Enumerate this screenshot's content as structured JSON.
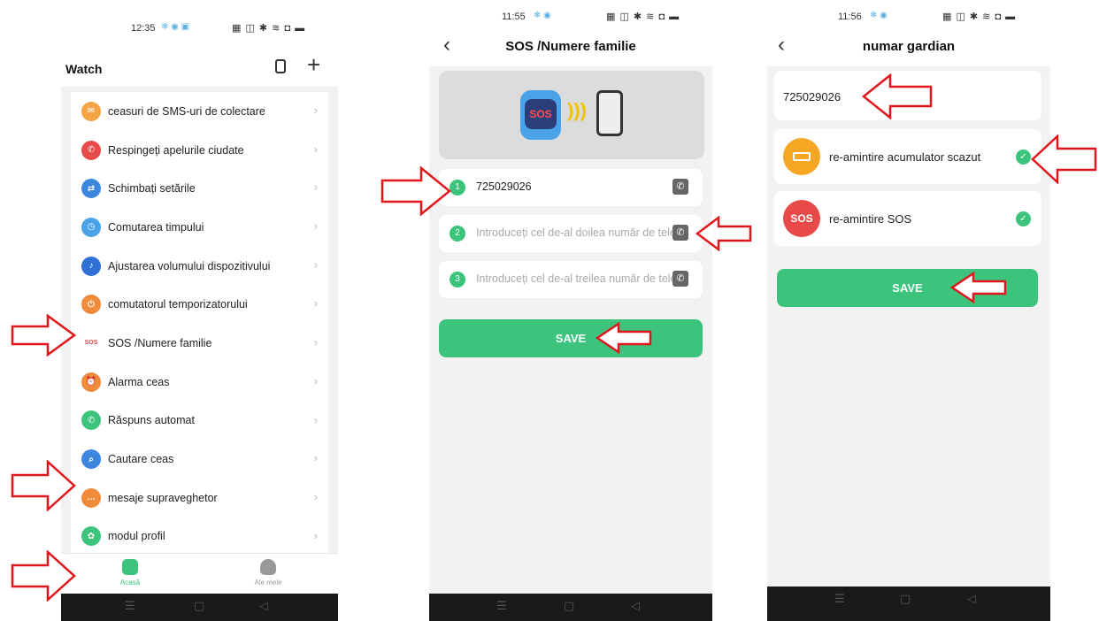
{
  "colors": {
    "accent": "#3cc47c",
    "arrow": "#e0161c",
    "bg": "#f2f2f2"
  },
  "screen1": {
    "status": {
      "time": "12:35"
    },
    "header": {
      "title": "Watch",
      "watch_icon": "watch-icon",
      "add_icon": "plus-icon"
    },
    "menu": [
      {
        "label": "ceasuri de SMS-uri de colectare",
        "icon": "sms-icon",
        "color": "#f5a445",
        "glyph": "✉"
      },
      {
        "label": "Respingeți apelurile ciudate",
        "icon": "reject-call-icon",
        "color": "#e84a4a",
        "glyph": "✆"
      },
      {
        "label": "Schimbați setările",
        "icon": "settings-toggle-icon",
        "color": "#3d86e0",
        "glyph": "⇄"
      },
      {
        "label": "Comutarea timpului",
        "icon": "time-switch-icon",
        "color": "#4aa3e8",
        "glyph": "◷"
      },
      {
        "label": "Ajustarea volumului dispozitivului",
        "icon": "volume-icon",
        "color": "#2f6fd6",
        "glyph": "♪"
      },
      {
        "label": "comutatorul temporizatorului",
        "icon": "timer-icon",
        "color": "#f08b3a",
        "glyph": "⏻"
      },
      {
        "label": "SOS /Numere familie",
        "icon": "sos-icon",
        "color": "#ffffff",
        "glyph": "SOS"
      },
      {
        "label": "Alarma ceas",
        "icon": "alarm-clock-icon",
        "color": "#f08b3a",
        "glyph": "⏰"
      },
      {
        "label": "Răspuns automat",
        "icon": "auto-answer-icon",
        "color": "#3cc47c",
        "glyph": "✆"
      },
      {
        "label": "Cautare ceas",
        "icon": "search-watch-icon",
        "color": "#3d86e0",
        "glyph": "⌕"
      },
      {
        "label": "mesaje supraveghetor",
        "icon": "chat-icon",
        "color": "#f08b3a",
        "glyph": "…"
      },
      {
        "label": "modul profil",
        "icon": "flower-icon",
        "color": "#3cc47c",
        "glyph": "✿"
      }
    ],
    "tabs": [
      {
        "label": "Acasă",
        "icon": "home-icon",
        "active": true
      },
      {
        "label": "Ale mele",
        "icon": "profile-icon",
        "active": false
      }
    ]
  },
  "screen2": {
    "status": {
      "time": "11:55"
    },
    "header": {
      "title": "SOS /Numere familie"
    },
    "numbers": [
      {
        "index": "1",
        "value": "725029026",
        "placeholder": ""
      },
      {
        "index": "2",
        "value": "",
        "placeholder": "Introduceți cel de-al doilea număr de telefon"
      },
      {
        "index": "3",
        "value": "",
        "placeholder": "Introduceți cel de-al treilea număr de telefon"
      }
    ],
    "save_label": "SAVE",
    "banner_sos": "SOS"
  },
  "screen3": {
    "status": {
      "time": "11:56"
    },
    "header": {
      "title": "numar gardian"
    },
    "guardian_number": "725029026",
    "options": [
      {
        "label": "re-amintire acumulator scazut",
        "icon": "battery-icon",
        "color": "#f5a623",
        "glyph": "▭",
        "checked": true
      },
      {
        "label": "re-amintire SOS",
        "icon": "sos-icon",
        "color": "#e84a4a",
        "glyph": "SOS",
        "checked": true
      }
    ],
    "save_label": "SAVE"
  }
}
